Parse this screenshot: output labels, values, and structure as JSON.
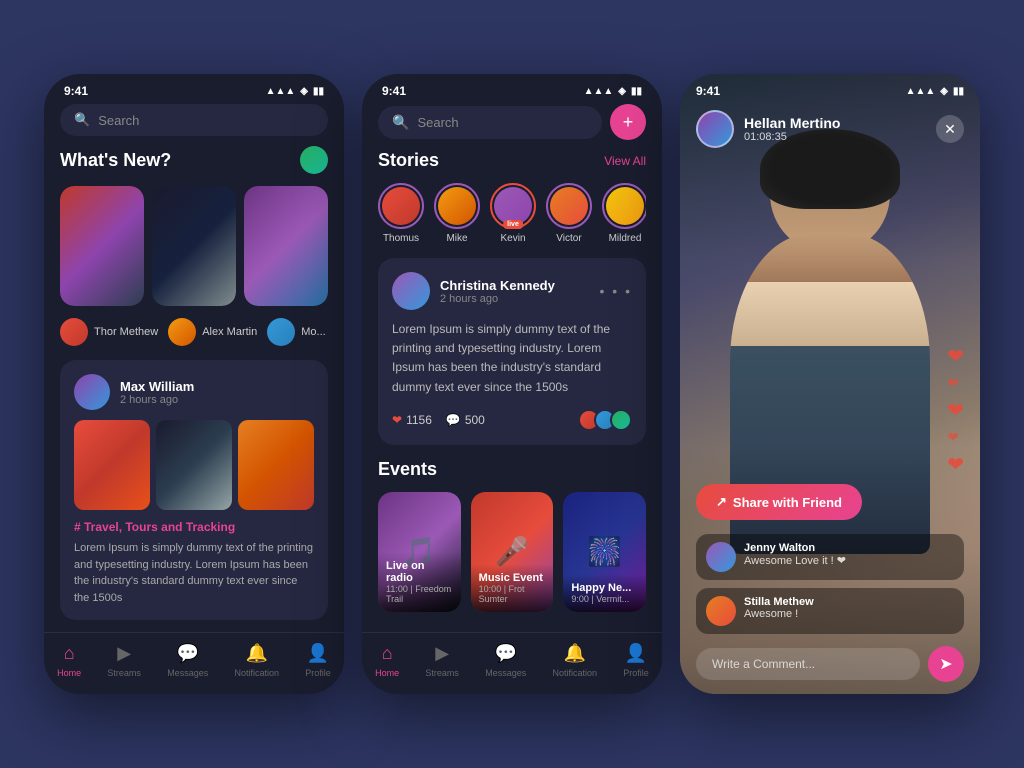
{
  "phone1": {
    "status": {
      "time": "9:41",
      "icons": "▲ ▲ ▲ 🔋"
    },
    "search": {
      "placeholder": "Search"
    },
    "whats_new": {
      "title": "What's New?"
    },
    "people": [
      {
        "name": "Thor Methew"
      },
      {
        "name": "Alex Martin"
      },
      {
        "name": "Mo..."
      }
    ],
    "post": {
      "author": "Max William",
      "time": "2 hours ago",
      "tag": "# Travel, Tours and Tracking",
      "text": "Lorem Ipsum is simply dummy text of the printing and typesetting industry. Lorem Ipsum has been the industry's standard dummy text ever since the 1500s"
    },
    "nav": [
      {
        "label": "Home",
        "icon": "⌂",
        "active": true
      },
      {
        "label": "Streams",
        "icon": "▶"
      },
      {
        "label": "Messages",
        "icon": "💬"
      },
      {
        "label": "Notification",
        "icon": "🔔"
      },
      {
        "label": "Profile",
        "icon": "👤"
      }
    ]
  },
  "phone2": {
    "status": {
      "time": "9:41"
    },
    "search": {
      "placeholder": "Search"
    },
    "stories": {
      "title": "Stories",
      "view_all": "View All",
      "items": [
        {
          "name": "Thomus",
          "live": false
        },
        {
          "name": "Mike",
          "live": false
        },
        {
          "name": "Kevin",
          "live": true
        },
        {
          "name": "Victor",
          "live": false
        },
        {
          "name": "Mildred",
          "live": false
        }
      ]
    },
    "post": {
      "author": "Christina Kennedy",
      "time": "2 hours ago",
      "text": "Lorem Ipsum is simply dummy text of the printing and typesetting industry. Lorem Ipsum has been the industry's standard dummy text ever since the 1500s",
      "likes": "1156",
      "comments": "500"
    },
    "events": {
      "title": "Events",
      "items": [
        {
          "name": "Live on radio",
          "time": "11:00",
          "location": "Freedom Trail"
        },
        {
          "name": "Music Event",
          "time": "10:00",
          "location": "Frot Sumter"
        },
        {
          "name": "Happy Ne...",
          "time": "9:00",
          "location": "Vermit..."
        }
      ]
    },
    "nav": [
      {
        "label": "Home",
        "icon": "⌂",
        "active": true
      },
      {
        "label": "Streams",
        "icon": "▶"
      },
      {
        "label": "Messages",
        "icon": "💬"
      },
      {
        "label": "Notification",
        "icon": "🔔"
      },
      {
        "label": "Profile",
        "icon": "👤"
      }
    ]
  },
  "phone3": {
    "status": {
      "time": "9:41"
    },
    "user": {
      "name": "Hellan Mertino",
      "time": "01:08:35"
    },
    "share_btn": "Share with Friend",
    "comments": [
      {
        "author": "Jenny Walton",
        "text": "Awesome Love it ! ❤"
      },
      {
        "author": "Stilla Methew",
        "text": "Awesome !"
      }
    ],
    "input_placeholder": "Write a Comment..."
  }
}
